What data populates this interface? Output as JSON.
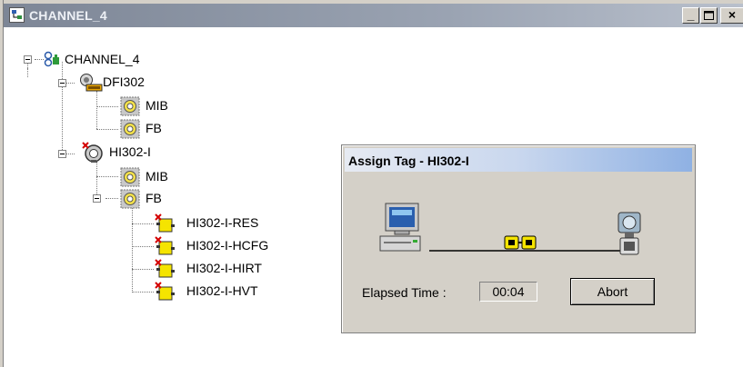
{
  "window": {
    "title": "CHANNEL_4",
    "minimize_label": "_",
    "maximize_label": "□",
    "close_label": "×"
  },
  "tree": {
    "root": "CHANNEL_4",
    "dfi": {
      "label": "DFI302",
      "children": [
        "MIB",
        "FB"
      ]
    },
    "hi": {
      "label": "HI302-I",
      "mib": "MIB",
      "fb": "FB",
      "blocks": [
        "HI302-I-RES",
        "HI302-I-HCFG",
        "HI302-I-HIRT",
        "HI302-I-HVT"
      ]
    }
  },
  "dialog": {
    "title": "Assign Tag - HI302-I",
    "elapsed_label": "Elapsed Time :",
    "elapsed_value": "00:04",
    "abort_label": "Abort"
  },
  "icons": {
    "title": "channel-icon",
    "root": "network-channel-icon",
    "dfi": "controller-device-icon",
    "mib": "mib-icon",
    "fb": "function-block-folder-icon",
    "hi": "field-device-icon",
    "block": "function-block-icon",
    "pc": "computer-icon",
    "connector": "coupler-icon",
    "transmitter": "transmitter-icon"
  },
  "colors": {
    "block_yellow": "#f5e400",
    "error_red": "#d40000",
    "dialog_title_blue": "#8fb1e3"
  }
}
